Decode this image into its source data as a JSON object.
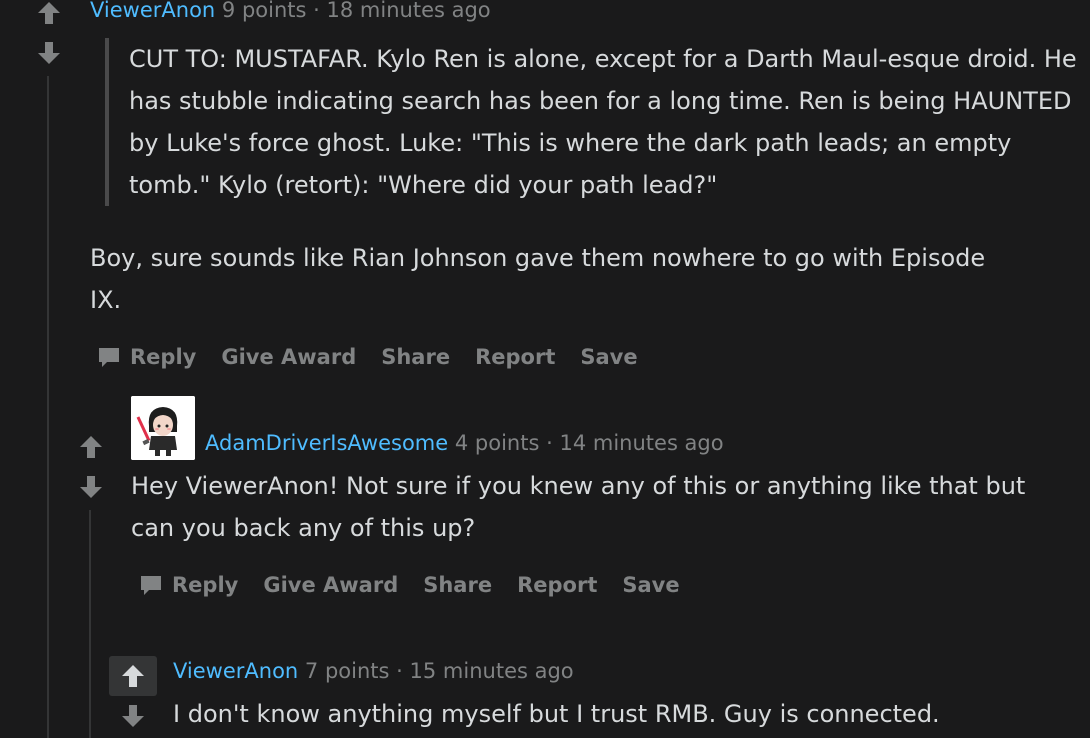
{
  "comment1": {
    "author": "ViewerAnon",
    "points": "9 points",
    "sep": "·",
    "time": "18 minutes ago",
    "quote": "CUT TO: MUSTAFAR. Kylo Ren is alone, except for a Darth Maul-esque droid. He has stubble indicating search has been for a long time. Ren is being HAUNTED by Luke's force ghost. Luke: \"This is where the dark path leads; an empty tomb.\" Kylo (retort): \"Where did your path lead?\"",
    "body": "Boy, sure sounds like Rian Johnson gave them nowhere to go with Episode IX.",
    "actions": {
      "reply": "Reply",
      "award": "Give Award",
      "share": "Share",
      "report": "Report",
      "save": "Save"
    }
  },
  "comment2": {
    "author": "AdamDriverIsAwesome",
    "points": "4 points",
    "sep": "·",
    "time": "14 minutes ago",
    "body": "Hey ViewerAnon! Not sure if you knew any of this or anything like that but can you back any of this up?",
    "actions": {
      "reply": "Reply",
      "award": "Give Award",
      "share": "Share",
      "report": "Report",
      "save": "Save"
    }
  },
  "comment3": {
    "author": "ViewerAnon",
    "points": "7 points",
    "sep": "·",
    "time": "15 minutes ago",
    "body": "I don't know anything myself but I trust RMB. Guy is connected."
  },
  "colors": {
    "background": "#1a1a1b",
    "author_link": "#4fbcff",
    "muted": "#818384",
    "text": "#d7dadc"
  }
}
